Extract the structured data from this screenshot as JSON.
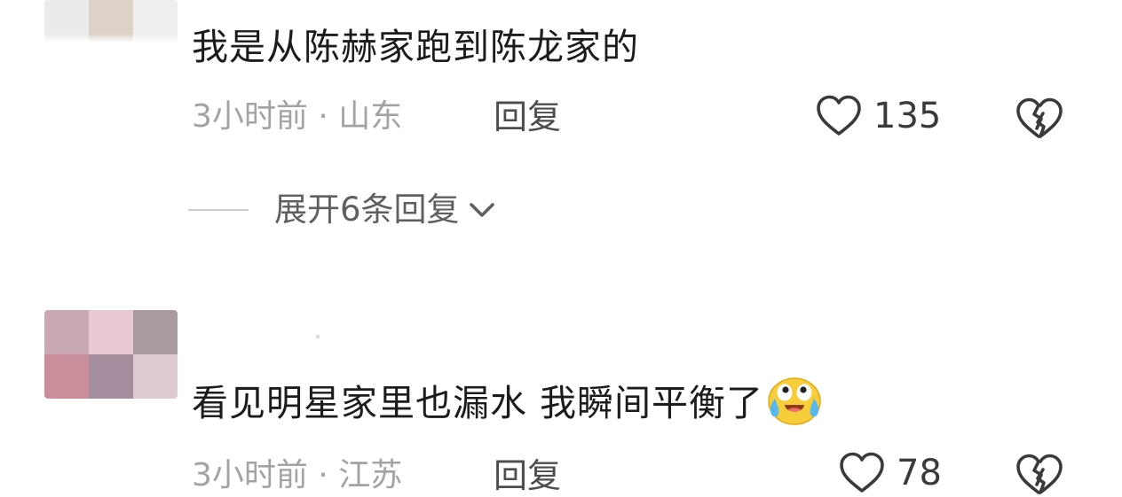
{
  "comments": [
    {
      "text": "我是从陈赫家跑到陈龙家的",
      "meta": "3小时前 · 山东",
      "reply_label": "回复",
      "likes": "135",
      "expand_label": "展开6条回复"
    },
    {
      "text": "看见明星家里也漏水 我瞬间平衡了",
      "emoji": "crying-laughing-emoji",
      "meta": "3小时前 · 江苏",
      "reply_label": "回复",
      "likes": "78"
    }
  ],
  "icons": {
    "like": "heart-outline-icon",
    "dislike": "broken-heart-icon",
    "expand": "chevron-down-icon"
  },
  "colors": {
    "text": "#1c1c1c",
    "meta": "#a3a3a3",
    "reply": "#4d4d4d",
    "icon": "#3a3a3a"
  }
}
